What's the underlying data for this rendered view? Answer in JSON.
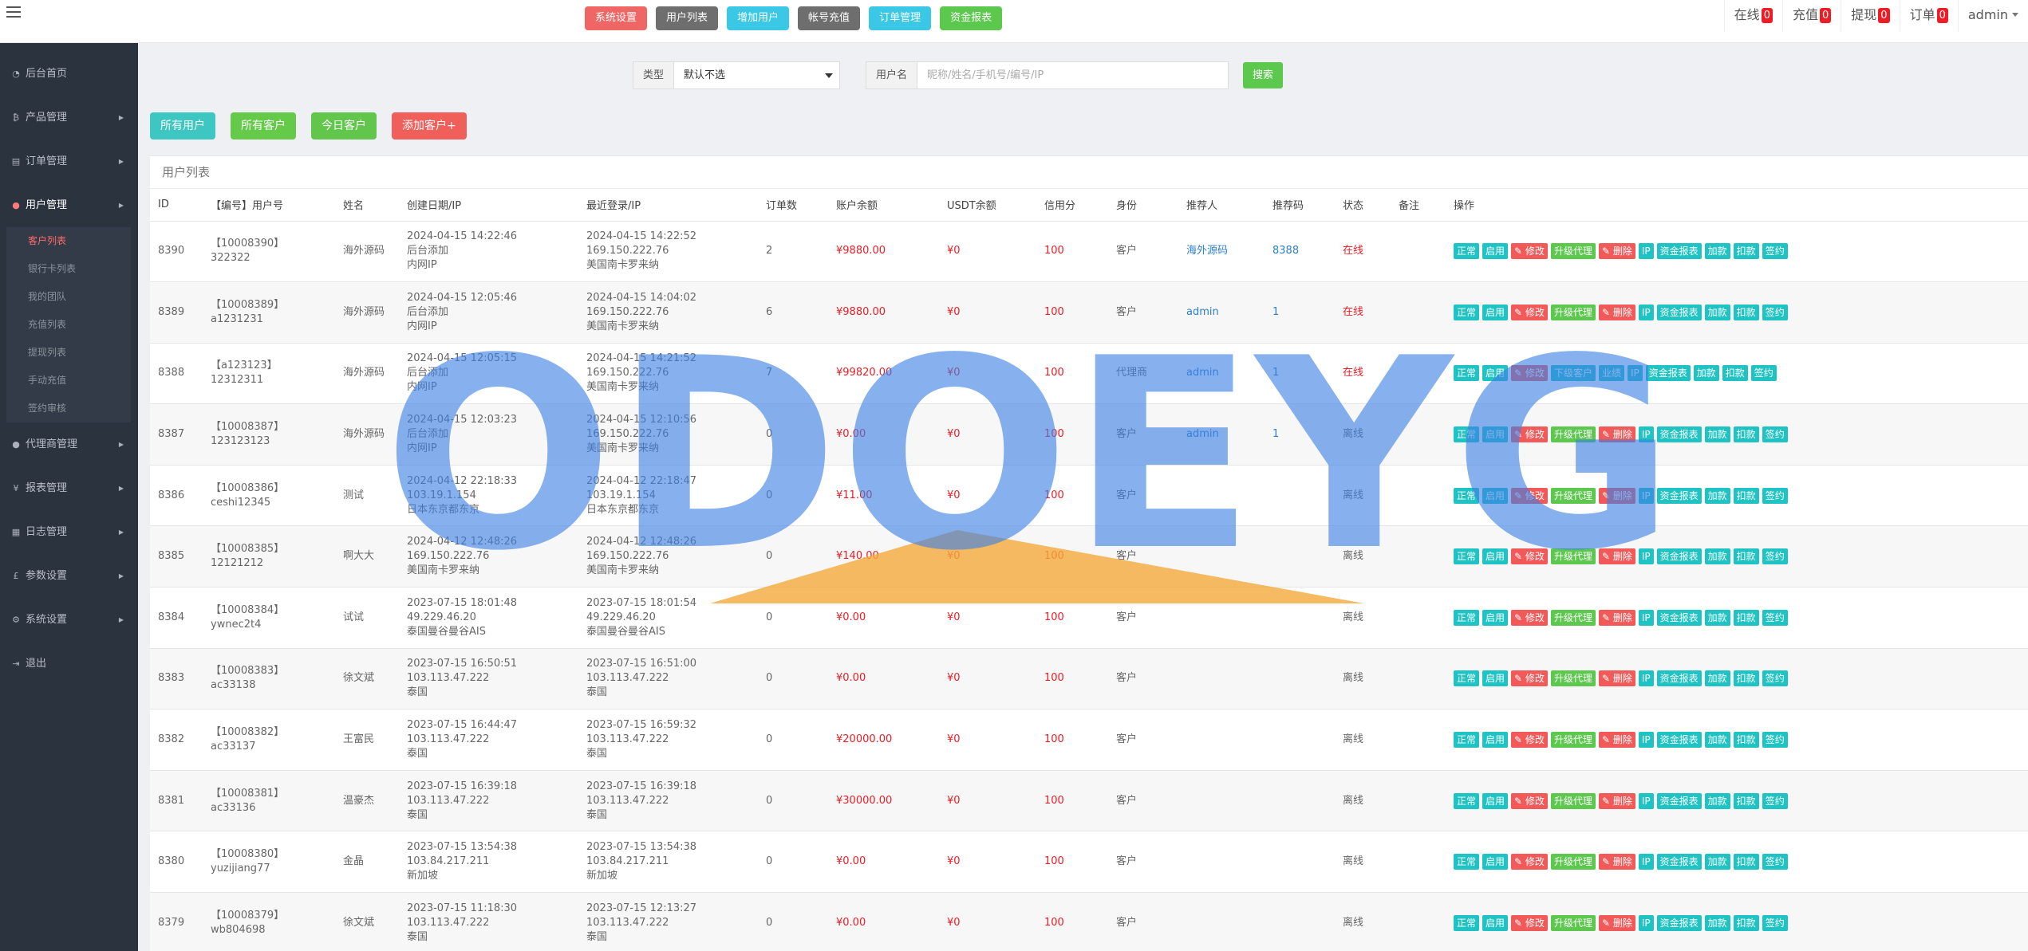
{
  "topnav": [
    {
      "label": "系统设置",
      "color": "#f06664"
    },
    {
      "label": "用户列表",
      "color": "#6e6e6e"
    },
    {
      "label": "增加用户",
      "color": "#3bc8e7"
    },
    {
      "label": "帐号充值",
      "color": "#6e6e6e"
    },
    {
      "label": "订单管理",
      "color": "#3bc8e7"
    },
    {
      "label": "资金报表",
      "color": "#5cc94e"
    }
  ],
  "topright": {
    "online": {
      "label": "在线",
      "count": "0"
    },
    "recharge": {
      "label": "充值",
      "count": "0"
    },
    "withdraw": {
      "label": "提现",
      "count": "0"
    },
    "orders": {
      "label": "订单",
      "count": "0"
    },
    "user": "admin"
  },
  "sidebar": {
    "items": [
      {
        "label": "后台首页",
        "icon": "speedometer-icon"
      },
      {
        "label": "产品管理",
        "icon": "bitcoin-icon"
      },
      {
        "label": "订单管理",
        "icon": "file-icon"
      },
      {
        "label": "用户管理",
        "icon": "user-icon"
      },
      {
        "label": "代理商管理",
        "icon": "users-icon"
      },
      {
        "label": "报表管理",
        "icon": "yen-icon"
      },
      {
        "label": "日志管理",
        "icon": "calendar-icon"
      },
      {
        "label": "参数设置",
        "icon": "pound-icon"
      },
      {
        "label": "系统设置",
        "icon": "gears-icon"
      },
      {
        "label": "退出",
        "icon": "sign-out-icon"
      }
    ],
    "subitems": [
      "客户列表",
      "银行卡列表",
      "我的团队",
      "充值列表",
      "提现列表",
      "手动充值",
      "签约审核"
    ]
  },
  "search": {
    "type_label": "类型",
    "type_value": "默认不选",
    "user_label": "用户名",
    "user_placeholder": "昵称/姓名/手机号/编号/IP",
    "button": "搜索"
  },
  "filters": [
    "所有用户",
    "所有客户",
    "今日客户",
    "添加客户+"
  ],
  "panel_title": "用户列表",
  "columns": [
    "ID",
    "【编号】用户号",
    "姓名",
    "创建日期/IP",
    "最近登录/IP",
    "订单数",
    "账户余额",
    "USDT余额",
    "信用分",
    "身份",
    "推荐人",
    "推荐码",
    "状态",
    "备注",
    "操作"
  ],
  "rows": [
    {
      "id": "8390",
      "code": "【10008390】",
      "user": "322322",
      "name": "海外源码",
      "created": "2024-04-15 14:22:46",
      "created_ip": "后台添加",
      "created_loc": "内网IP",
      "login": "2024-04-15 14:22:52",
      "login_ip": "169.150.222.76",
      "login_loc": "美国南卡罗来纳",
      "orders": "2",
      "balance": "¥9880.00",
      "usdt": "¥0",
      "credit": "100",
      "role": "客户",
      "referrer": "海外源码",
      "refcode": "8388",
      "status": "在线",
      "remark": ""
    },
    {
      "id": "8389",
      "code": "【10008389】",
      "user": "a1231231",
      "name": "海外源码",
      "created": "2024-04-15 12:05:46",
      "created_ip": "后台添加",
      "created_loc": "内网IP",
      "login": "2024-04-15 14:04:02",
      "login_ip": "169.150.222.76",
      "login_loc": "美国南卡罗来纳",
      "orders": "6",
      "balance": "¥9880.00",
      "usdt": "¥0",
      "credit": "100",
      "role": "客户",
      "referrer": "admin",
      "refcode": "1",
      "status": "在线",
      "remark": ""
    },
    {
      "id": "8388",
      "code": "【a123123】",
      "user": "12312311",
      "name": "海外源码",
      "created": "2024-04-15 12:05:15",
      "created_ip": "后台添加",
      "created_loc": "内网IP",
      "login": "2024-04-15 14:21:52",
      "login_ip": "169.150.222.76",
      "login_loc": "美国南卡罗来纳",
      "orders": "7",
      "balance": "¥99820.00",
      "usdt": "¥0",
      "credit": "100",
      "role": "代理商",
      "referrer": "admin",
      "refcode": "1",
      "status": "在线",
      "remark": "",
      "agent": true
    },
    {
      "id": "8387",
      "code": "【10008387】",
      "user": "123123123",
      "name": "海外源码",
      "created": "2024-04-15 12:03:23",
      "created_ip": "后台添加",
      "created_loc": "内网IP",
      "login": "2024-04-15 12:10:56",
      "login_ip": "169.150.222.76",
      "login_loc": "美国南卡罗来纳",
      "orders": "0",
      "balance": "¥0.00",
      "usdt": "¥0",
      "credit": "100",
      "role": "客户",
      "referrer": "admin",
      "refcode": "1",
      "status": "离线",
      "remark": ""
    },
    {
      "id": "8386",
      "code": "【10008386】",
      "user": "ceshi12345",
      "name": "测试",
      "created": "2024-04-12 22:18:33",
      "created_ip": "103.19.1.154",
      "created_loc": "日本东京都东京",
      "login": "2024-04-12 22:18:47",
      "login_ip": "103.19.1.154",
      "login_loc": "日本东京都东京",
      "orders": "0",
      "balance": "¥11.00",
      "usdt": "¥0",
      "credit": "100",
      "role": "客户",
      "referrer": "",
      "refcode": "",
      "status": "离线",
      "remark": ""
    },
    {
      "id": "8385",
      "code": "【10008385】",
      "user": "12121212",
      "name": "啊大大",
      "created": "2024-04-12 12:48:26",
      "created_ip": "169.150.222.76",
      "created_loc": "美国南卡罗来纳",
      "login": "2024-04-12 12:48:26",
      "login_ip": "169.150.222.76",
      "login_loc": "美国南卡罗来纳",
      "orders": "0",
      "balance": "¥140.00",
      "usdt": "¥0",
      "credit": "100",
      "role": "客户",
      "referrer": "",
      "refcode": "",
      "status": "离线",
      "remark": ""
    },
    {
      "id": "8384",
      "code": "【10008384】",
      "user": "ywnec2t4",
      "name": "试试",
      "created": "2023-07-15 18:01:48",
      "created_ip": "49.229.46.20",
      "created_loc": "泰国曼谷曼谷AIS",
      "login": "2023-07-15 18:01:54",
      "login_ip": "49.229.46.20",
      "login_loc": "泰国曼谷曼谷AIS",
      "orders": "0",
      "balance": "¥0.00",
      "usdt": "¥0",
      "credit": "100",
      "role": "客户",
      "referrer": "",
      "refcode": "",
      "status": "离线",
      "remark": ""
    },
    {
      "id": "8383",
      "code": "【10008383】",
      "user": "ac33138",
      "name": "徐文斌",
      "created": "2023-07-15 16:50:51",
      "created_ip": "103.113.47.222",
      "created_loc": "泰国",
      "login": "2023-07-15 16:51:00",
      "login_ip": "103.113.47.222",
      "login_loc": "泰国",
      "orders": "0",
      "balance": "¥0.00",
      "usdt": "¥0",
      "credit": "100",
      "role": "客户",
      "referrer": "",
      "refcode": "",
      "status": "离线",
      "remark": ""
    },
    {
      "id": "8382",
      "code": "【10008382】",
      "user": "ac33137",
      "name": "王富民",
      "created": "2023-07-15 16:44:47",
      "created_ip": "103.113.47.222",
      "created_loc": "泰国",
      "login": "2023-07-15 16:59:32",
      "login_ip": "103.113.47.222",
      "login_loc": "泰国",
      "orders": "0",
      "balance": "¥20000.00",
      "usdt": "¥0",
      "credit": "100",
      "role": "客户",
      "referrer": "",
      "refcode": "",
      "status": "离线",
      "remark": ""
    },
    {
      "id": "8381",
      "code": "【10008381】",
      "user": "ac33136",
      "name": "温豪杰",
      "created": "2023-07-15 16:39:18",
      "created_ip": "103.113.47.222",
      "created_loc": "泰国",
      "login": "2023-07-15 16:39:18",
      "login_ip": "103.113.47.222",
      "login_loc": "泰国",
      "orders": "0",
      "balance": "¥30000.00",
      "usdt": "¥0",
      "credit": "100",
      "role": "客户",
      "referrer": "",
      "refcode": "",
      "status": "离线",
      "remark": ""
    },
    {
      "id": "8380",
      "code": "【10008380】",
      "user": "yuzijiang77",
      "name": "金晶",
      "created": "2023-07-15 13:54:38",
      "created_ip": "103.84.217.211",
      "created_loc": "新加坡",
      "login": "2023-07-15 13:54:38",
      "login_ip": "103.84.217.211",
      "login_loc": "新加坡",
      "orders": "0",
      "balance": "¥0.00",
      "usdt": "¥0",
      "credit": "100",
      "role": "客户",
      "referrer": "",
      "refcode": "",
      "status": "离线",
      "remark": ""
    },
    {
      "id": "8379",
      "code": "【10008379】",
      "user": "wb804698",
      "name": "徐文斌",
      "created": "2023-07-15 11:18:30",
      "created_ip": "103.113.47.222",
      "created_loc": "泰国",
      "login": "2023-07-15 12:13:27",
      "login_ip": "103.113.47.222",
      "login_loc": "泰国",
      "orders": "0",
      "balance": "¥0.00",
      "usdt": "¥0",
      "credit": "100",
      "role": "客户",
      "referrer": "",
      "refcode": "",
      "status": "离线",
      "remark": ""
    }
  ],
  "ops_customer": [
    {
      "label": "正常",
      "icon": "",
      "color": "#20c3c3"
    },
    {
      "label": "启用",
      "icon": "",
      "color": "#20c3c3"
    },
    {
      "label": "修改",
      "icon": "pencil-icon",
      "color": "#f25a5a"
    },
    {
      "label": "升级代理",
      "icon": "",
      "color": "#5cc94e"
    },
    {
      "label": "删除",
      "icon": "pencil-icon",
      "color": "#f25a5a"
    },
    {
      "label": "IP",
      "icon": "",
      "color": "#20c3c3"
    },
    {
      "label": "资金报表",
      "icon": "",
      "color": "#20c3c3"
    },
    {
      "label": "加款",
      "icon": "",
      "color": "#20c3c3"
    },
    {
      "label": "扣款",
      "icon": "",
      "color": "#20c3c3"
    },
    {
      "label": "签约",
      "icon": "",
      "color": "#20c3c3"
    }
  ],
  "ops_agent": [
    {
      "label": "正常",
      "icon": "",
      "color": "#20c3c3"
    },
    {
      "label": "启用",
      "icon": "",
      "color": "#20c3c3"
    },
    {
      "label": "修改",
      "icon": "pencil-icon",
      "color": "#f25a5a"
    },
    {
      "label": "下级客户",
      "icon": "",
      "color": "#20c3c3"
    },
    {
      "label": "业绩",
      "icon": "",
      "color": "#20c3c3"
    },
    {
      "label": "IP",
      "icon": "",
      "color": "#20c3c3"
    },
    {
      "label": "资金报表",
      "icon": "",
      "color": "#20c3c3"
    },
    {
      "label": "加款",
      "icon": "",
      "color": "#20c3c3"
    },
    {
      "label": "扣款",
      "icon": "",
      "color": "#20c3c3"
    },
    {
      "label": "签约",
      "icon": "",
      "color": "#20c3c3"
    }
  ],
  "watermark": "ODOEYG"
}
